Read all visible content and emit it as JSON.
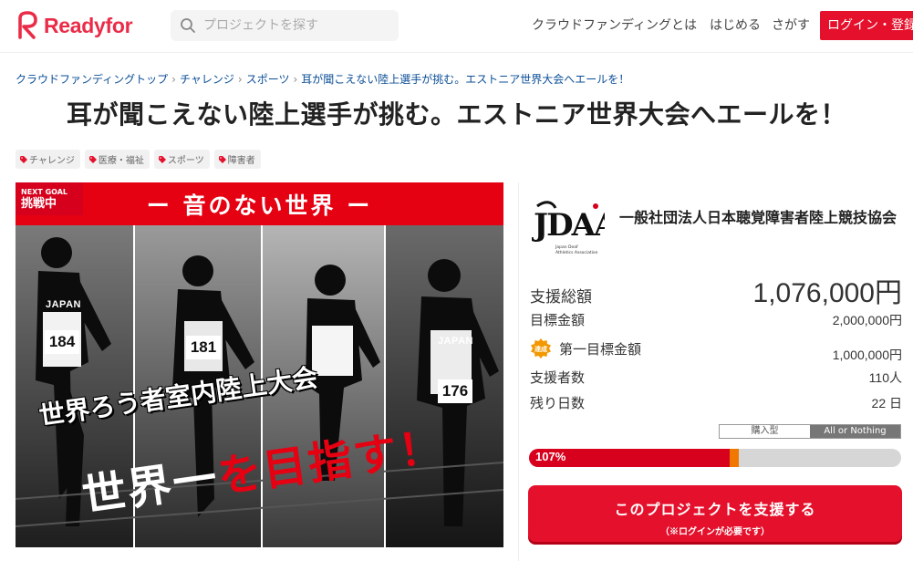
{
  "header": {
    "logo_text": "Readyfor",
    "search_placeholder": "プロジェクトを探す",
    "nav": {
      "crowdfunding": "クラウドファンディングとは",
      "start": "はじめる",
      "find": "さがす"
    },
    "login_label": "ログイン・登録"
  },
  "breadcrumb": [
    "クラウドファンディングトップ",
    "チャレンジ",
    "スポーツ",
    "耳が聞こえない陸上選手が挑む。エストニア世界大会へエールを！"
  ],
  "title": "耳が聞こえない陸上選手が挑む。エストニア世界大会へエールを！",
  "tags": [
    "チャレンジ",
    "医療・福祉",
    "スポーツ",
    "障害者"
  ],
  "hero": {
    "next_goal_label": "NEXT GOAL",
    "next_goal_status": "挑戦中",
    "band_text": "ー 音のない世界 ー",
    "event_text": "世界ろう者室内陸上大会",
    "slogan_white": "世界一",
    "slogan_red": "を目指す！",
    "jersey_word": "JAPAN",
    "bibs": [
      "184",
      "181",
      "176"
    ]
  },
  "organization": {
    "logo_text": "JDAA",
    "logo_subtext": "Japan Deaf Athletics Association",
    "name": "一般社団法人日本聴覚障害者陸上競技協会"
  },
  "stats": {
    "total_label": "支援総額",
    "total_value": "1,076,000円",
    "goal_label": "目標金額",
    "goal_value": "2,000,000円",
    "first_goal_badge": "達成",
    "first_goal_label": "第一目標金額",
    "first_goal_value": "1,000,000円",
    "supporters_label": "支援者数",
    "supporters_value": "110人",
    "days_label": "残り日数",
    "days_value": "22 日"
  },
  "funding_type": {
    "purchase": "購入型",
    "all_or_nothing": "All or Nothing",
    "selected": "All or Nothing"
  },
  "progress": {
    "percent_text": "107%",
    "first_goal_fraction": 0.5,
    "funded_fraction": 0.538
  },
  "support_button": {
    "label": "このプロジェクトを支援する",
    "note": "（※ログインが必要です）"
  },
  "colors": {
    "brand_red": "#e5102c",
    "progress_red": "#d7001d",
    "progress_orange": "#f07800",
    "link_blue": "#0a4d97"
  }
}
